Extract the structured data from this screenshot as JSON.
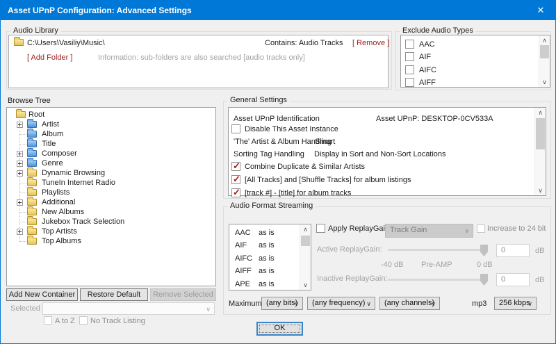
{
  "window": {
    "title": "Asset UPnP Configuration: Advanced Settings",
    "close_glyph": "✕",
    "accent_blue": "#0078d7",
    "accent_red": "#9e1b1b"
  },
  "audio_library": {
    "legend": "Audio Library",
    "path": "C:\\Users\\Vasiliy\\Music\\",
    "contains": "Contains: Audio Tracks",
    "remove_link": "[ Remove ]",
    "add_folder_link": "[ Add Folder ]",
    "info": "Information: sub-folders are also searched [audio tracks only]"
  },
  "exclude_audio_types": {
    "legend": "Exclude Audio Types",
    "items": [
      {
        "label": "AAC",
        "checked": false
      },
      {
        "label": "AIF",
        "checked": false
      },
      {
        "label": "AIFC",
        "checked": false
      },
      {
        "label": "AIFF",
        "checked": false
      }
    ]
  },
  "browse_tree": {
    "label": "Browse Tree",
    "root": "Root",
    "items": [
      {
        "label": "Artist",
        "folder": "blue",
        "expandable": true
      },
      {
        "label": "Album",
        "folder": "blue",
        "expandable": false
      },
      {
        "label": "Title",
        "folder": "blue",
        "expandable": false
      },
      {
        "label": "Composer",
        "folder": "blue",
        "expandable": true
      },
      {
        "label": "Genre",
        "folder": "blue",
        "expandable": true
      },
      {
        "label": "Dynamic Browsing",
        "folder": "yellow",
        "expandable": true
      },
      {
        "label": "TuneIn Internet Radio",
        "folder": "yellow",
        "expandable": false
      },
      {
        "label": "Playlists",
        "folder": "yellow",
        "expandable": false
      },
      {
        "label": "Additional",
        "folder": "yellow",
        "expandable": true
      },
      {
        "label": "New Albums",
        "folder": "yellow",
        "expandable": false
      },
      {
        "label": "Jukebox Track Selection",
        "folder": "yellow",
        "expandable": false
      },
      {
        "label": "Top Artists",
        "folder": "yellow",
        "expandable": true
      },
      {
        "label": "Top Albums",
        "folder": "yellow",
        "expandable": false
      }
    ],
    "buttons": {
      "add": "Add New Container",
      "restore": "Restore Default",
      "remove": "Remove Selected"
    },
    "selected_label": "Selected",
    "a_to_z": "A to Z",
    "no_track_listing": "No Track Listing"
  },
  "general_settings": {
    "legend": "General Settings",
    "identification_label": "Asset UPnP Identification",
    "identification_value": "Asset UPnP: DESKTOP-0CV533A",
    "disable_instance": {
      "label": "Disable This Asset Instance",
      "checked": false
    },
    "the_handling_label": "'The' Artist & Album Handling",
    "the_handling_value": "Smart",
    "sorting_label": "Sorting Tag Handling",
    "sorting_value": "Display in Sort and Non-Sort Locations",
    "combine_artists": {
      "label": "Combine Duplicate & Similar Artists",
      "checked": true
    },
    "all_tracks": {
      "label": "[All Tracks] and [Shuffle Tracks] for album listings",
      "checked": true
    },
    "track_title": {
      "label": "[track #] - [title] for album tracks",
      "checked": true
    }
  },
  "audio_format_streaming": {
    "legend": "Audio Format Streaming",
    "formats": [
      {
        "name": "AAC",
        "mode": "as is"
      },
      {
        "name": "AIF",
        "mode": "as is"
      },
      {
        "name": "AIFC",
        "mode": "as is"
      },
      {
        "name": "AIFF",
        "mode": "as is"
      },
      {
        "name": "APE",
        "mode": "as is"
      }
    ],
    "apply_replaygain": {
      "label": "Apply ReplayGain",
      "checked": false
    },
    "gain_mode": "Track Gain",
    "increase_24bit": {
      "label": "Increase to 24 bit",
      "checked": false
    },
    "active_label": "Active ReplayGain:",
    "inactive_label": "Inactive ReplayGain:",
    "active_value": "0",
    "inactive_value": "0",
    "db_unit": "dB",
    "scale_min": "-40 dB",
    "scale_mid": "Pre-AMP",
    "scale_max": "0 dB",
    "maximum_label": "Maximum",
    "bits": "(any bits)",
    "frequency": "(any frequency)",
    "channels": "(any channels)",
    "mp3_label": "mp3",
    "mp3_bitrate": "256 kbps"
  },
  "ok_label": "OK"
}
